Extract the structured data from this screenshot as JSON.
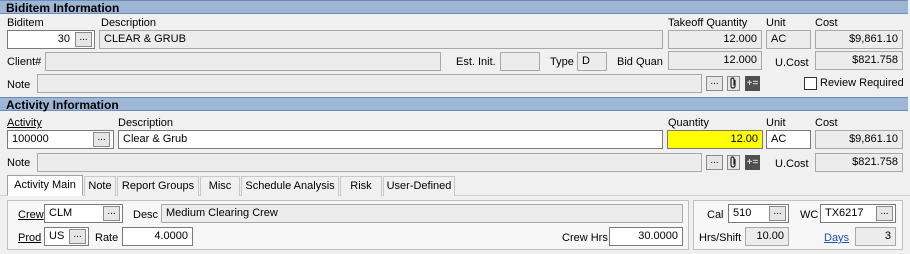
{
  "biditem": {
    "header": "Biditem Information",
    "biditem_label": "Biditem",
    "biditem_value": "30",
    "description_label": "Description",
    "description_value": "CLEAR & GRUB",
    "takeoff_label": "Takeoff Quantity",
    "takeoff_value": "12.000",
    "unit_label": "Unit",
    "unit_value": "AC",
    "cost_label": "Cost",
    "cost_value": "$9,861.10",
    "client_label": "Client#",
    "client_value": "",
    "est_init_label": "Est. Init.",
    "est_init_value": "",
    "type_label": "Type",
    "type_value": "D",
    "bid_quan_label": "Bid Quan",
    "bid_quan_value": "12.000",
    "ucost_label": "U.Cost",
    "ucost_value": "$821.758",
    "note_label": "Note",
    "note_value": "",
    "review_required_label": "Review Required",
    "review_required_checked": false
  },
  "activity": {
    "header": "Activity Information",
    "activity_label": "Activity",
    "activity_value": "100000",
    "description_label": "Description",
    "description_value": "Clear & Grub",
    "quantity_label": "Quantity",
    "quantity_value": "12.00",
    "unit_label": "Unit",
    "unit_value": "AC",
    "cost_label": "Cost",
    "cost_value": "$9,861.10",
    "note_label": "Note",
    "note_value": "",
    "ucost_label": "U.Cost",
    "ucost_value": "$821.758"
  },
  "tabs": [
    "Activity Main",
    "Note",
    "Report Groups",
    "Misc",
    "Schedule Analysis",
    "Risk",
    "User-Defined"
  ],
  "active_tab": "Activity Main",
  "main": {
    "crew_label": "Crew",
    "crew_value": "CLM",
    "desc_label": "Desc",
    "desc_value": "Medium Clearing Crew",
    "prod_label": "Prod",
    "prod_value": "US",
    "rate_label": "Rate",
    "rate_value": "4.0000",
    "crew_hrs_label": "Crew Hrs",
    "crew_hrs_value": "30.0000",
    "cal_label": "Cal",
    "cal_value": "510",
    "wc_label": "WC",
    "wc_value": "TX6217",
    "hrs_shift_label": "Hrs/Shift",
    "hrs_shift_value": "10.00",
    "days_label": "Days",
    "days_value": "3"
  },
  "ellipsis": "...",
  "icons": {
    "paperclip": "paperclip-icon",
    "note": "note-list-icon",
    "ellipsis": "ellipsis-icon"
  },
  "colors": {
    "header_bg": "#9db6d6",
    "highlight": "#ffff00",
    "link": "#1f4fbf"
  }
}
